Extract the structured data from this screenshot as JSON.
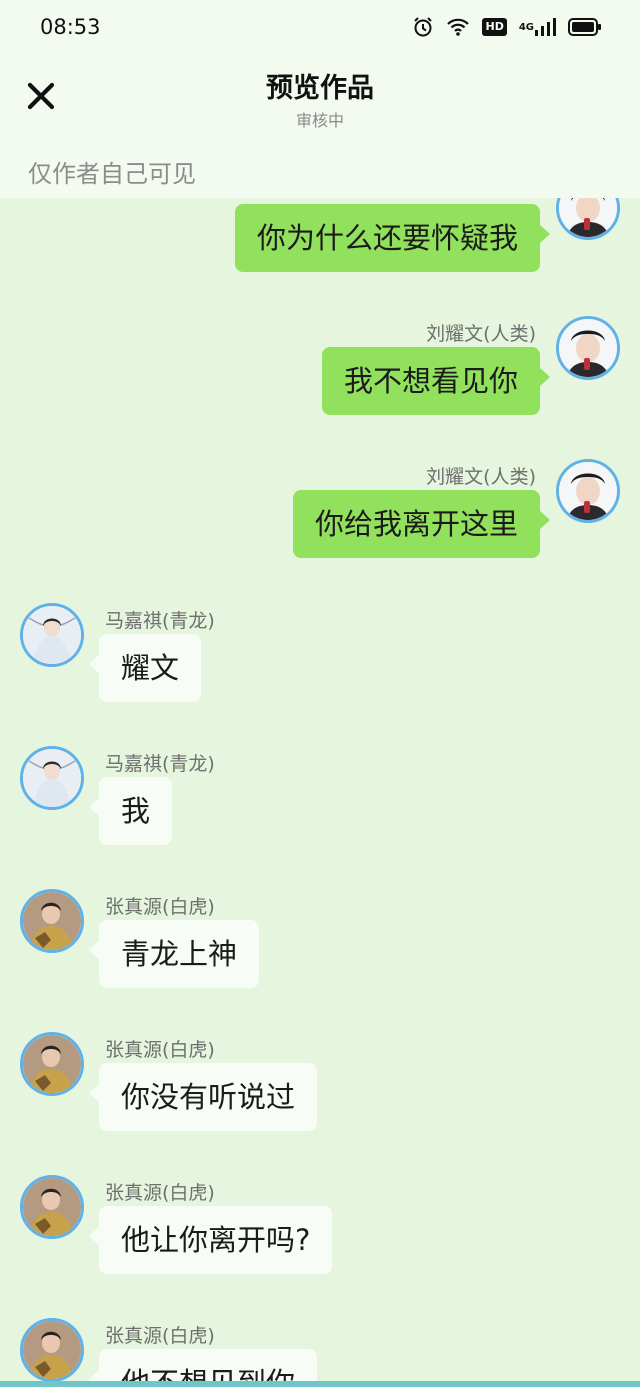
{
  "status": {
    "time": "08:53",
    "icons": [
      "alarm-icon",
      "wifi-icon",
      "hd-badge",
      "signal-icon",
      "battery-icon"
    ],
    "hd_label": "HD",
    "network_label": "4G"
  },
  "header": {
    "close_icon": "close-icon",
    "title": "预览作品",
    "subtitle": "审核中"
  },
  "notice": "仅作者自己可见",
  "colors": {
    "background": "#e6f5dd",
    "bubble_self": "#92e15d",
    "bubble_other": "#f7fcf6",
    "avatar_border": "#5fb2e8"
  },
  "messages": [
    {
      "side": "right",
      "sender": "",
      "text": "你为什么还要怀疑我",
      "avatar": "liu-yaowen-avatar"
    },
    {
      "side": "right",
      "sender": "刘耀文(人类)",
      "text": "我不想看见你",
      "avatar": "liu-yaowen-avatar"
    },
    {
      "side": "right",
      "sender": "刘耀文(人类)",
      "text": "你给我离开这里",
      "avatar": "liu-yaowen-avatar"
    },
    {
      "side": "left",
      "sender": "马嘉祺(青龙)",
      "text": "耀文",
      "avatar": "ma-jiaqi-avatar"
    },
    {
      "side": "left",
      "sender": "马嘉祺(青龙)",
      "text": "我",
      "avatar": "ma-jiaqi-avatar"
    },
    {
      "side": "left",
      "sender": "张真源(白虎)",
      "text": "青龙上神",
      "avatar": "zhang-zhenyuan-avatar"
    },
    {
      "side": "left",
      "sender": "张真源(白虎)",
      "text": "你没有听说过",
      "avatar": "zhang-zhenyuan-avatar"
    },
    {
      "side": "left",
      "sender": "张真源(白虎)",
      "text": "他让你离开吗?",
      "avatar": "zhang-zhenyuan-avatar"
    },
    {
      "side": "left",
      "sender": "张真源(白虎)",
      "text": "他不想见到你",
      "avatar": "zhang-zhenyuan-avatar"
    }
  ]
}
